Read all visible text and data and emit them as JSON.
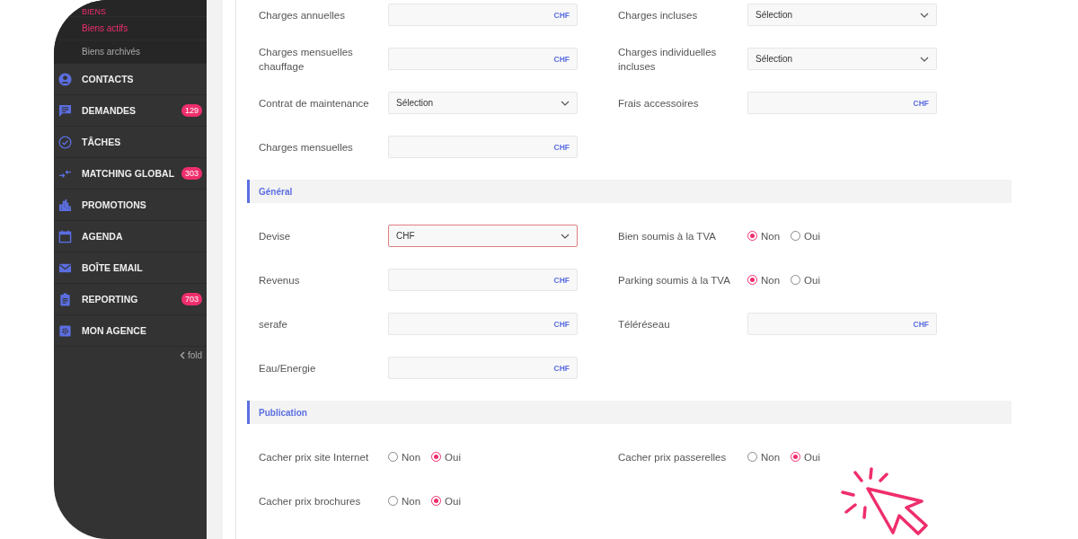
{
  "sidebar": {
    "section_title": "BIENS",
    "sub_items": [
      {
        "label": "Biens actifs",
        "selected": true
      },
      {
        "label": "Biens archivés",
        "selected": false
      }
    ],
    "items": [
      {
        "label": "CONTACTS"
      },
      {
        "label": "DEMANDES",
        "badge": "129"
      },
      {
        "label": "TÂCHES"
      },
      {
        "label": "MATCHING GLOBAL",
        "badge": "303"
      },
      {
        "label": "PROMOTIONS"
      },
      {
        "label": "AGENDA"
      },
      {
        "label": "BOÎTE EMAIL"
      },
      {
        "label": "REPORTING",
        "badge": "703"
      },
      {
        "label": "MON AGENCE"
      }
    ],
    "fold_label": "fold"
  },
  "sections": [
    {
      "rows": [
        [
          {
            "label": "Charges annuelles",
            "kind": "currency",
            "suffix": "CHF"
          },
          {
            "label": "Charges incluses",
            "kind": "select",
            "value": "Sélection",
            "error": false
          }
        ],
        [
          {
            "label": "Charges mensuelles chauffage",
            "kind": "currency",
            "suffix": "CHF"
          },
          {
            "label": "Charges individuelles incluses",
            "kind": "select",
            "value": "Sélection",
            "error": false
          }
        ],
        [
          {
            "label": "Contrat de maintenance",
            "kind": "select",
            "value": "Sélection",
            "error": false
          },
          {
            "label": "Frais accessoires",
            "kind": "currency",
            "suffix": "CHF"
          }
        ],
        [
          {
            "label": "Charges mensuelles",
            "kind": "currency",
            "suffix": "CHF"
          },
          null
        ]
      ]
    },
    {
      "title": "Général",
      "rows": [
        [
          {
            "label": "Devise",
            "kind": "select",
            "value": "CHF",
            "error": true
          },
          {
            "label": "Bien soumis à la TVA",
            "kind": "radio",
            "options": [
              {
                "label": "Non",
                "selected": true
              },
              {
                "label": "Oui",
                "selected": false
              }
            ]
          }
        ],
        [
          {
            "label": "Revenus",
            "kind": "currency",
            "suffix": "CHF"
          },
          {
            "label": "Parking soumis à la TVA",
            "kind": "radio",
            "options": [
              {
                "label": "Non",
                "selected": true
              },
              {
                "label": "Oui",
                "selected": false
              }
            ]
          }
        ],
        [
          {
            "label": "serafe",
            "kind": "currency",
            "suffix": "CHF"
          },
          {
            "label": "Téléréseau",
            "kind": "currency",
            "suffix": "CHF"
          }
        ],
        [
          {
            "label": "Eau/Energie",
            "kind": "currency",
            "suffix": "CHF"
          },
          null
        ]
      ]
    },
    {
      "title": "Publication",
      "rows": [
        [
          {
            "label": "Cacher prix site Internet",
            "kind": "radio",
            "options": [
              {
                "label": "Non",
                "selected": false
              },
              {
                "label": "Oui",
                "selected": true
              }
            ]
          },
          {
            "label": "Cacher prix passerelles",
            "kind": "radio",
            "options": [
              {
                "label": "Non",
                "selected": false
              },
              {
                "label": "Oui",
                "selected": true
              }
            ]
          }
        ],
        [
          {
            "label": "Cacher prix brochures",
            "kind": "radio",
            "options": [
              {
                "label": "Non",
                "selected": false
              },
              {
                "label": "Oui",
                "selected": true
              }
            ]
          },
          null
        ]
      ]
    }
  ]
}
